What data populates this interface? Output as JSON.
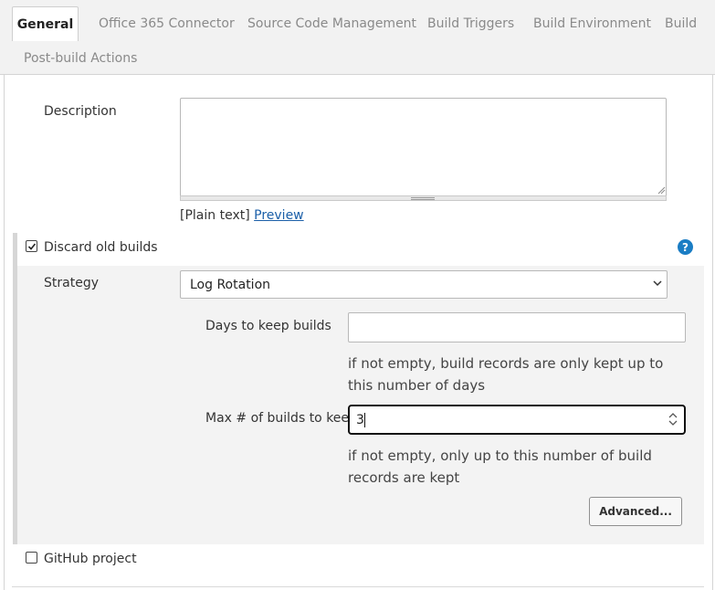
{
  "tabs": {
    "active": "General",
    "items": [
      "Office 365 Connector",
      "Source Code Management",
      "Build Triggers",
      "Build Environment",
      "Build",
      "Post-build Actions"
    ]
  },
  "description": {
    "label": "Description",
    "value": "",
    "format_prefix": "[Plain text]",
    "preview_link": "Preview"
  },
  "discard_old_builds": {
    "label": "Discard old builds",
    "checked": true,
    "help_icon": "question-circle-icon",
    "strategy_label": "Strategy",
    "strategy_value": "Log Rotation",
    "days_label": "Days to keep builds",
    "days_value": "",
    "days_hint": "if not empty, build records are only kept up to this number of days",
    "max_label": "Max # of builds to keep",
    "max_value": "3",
    "max_hint": "if not empty, only up to this number of build records are kept",
    "advanced_button": "Advanced..."
  },
  "github_project": {
    "label": "GitHub project",
    "checked": false
  },
  "colors": {
    "link": "#1b5fa8",
    "help": "#1a7dc4",
    "panel": "#f3f3f3"
  }
}
